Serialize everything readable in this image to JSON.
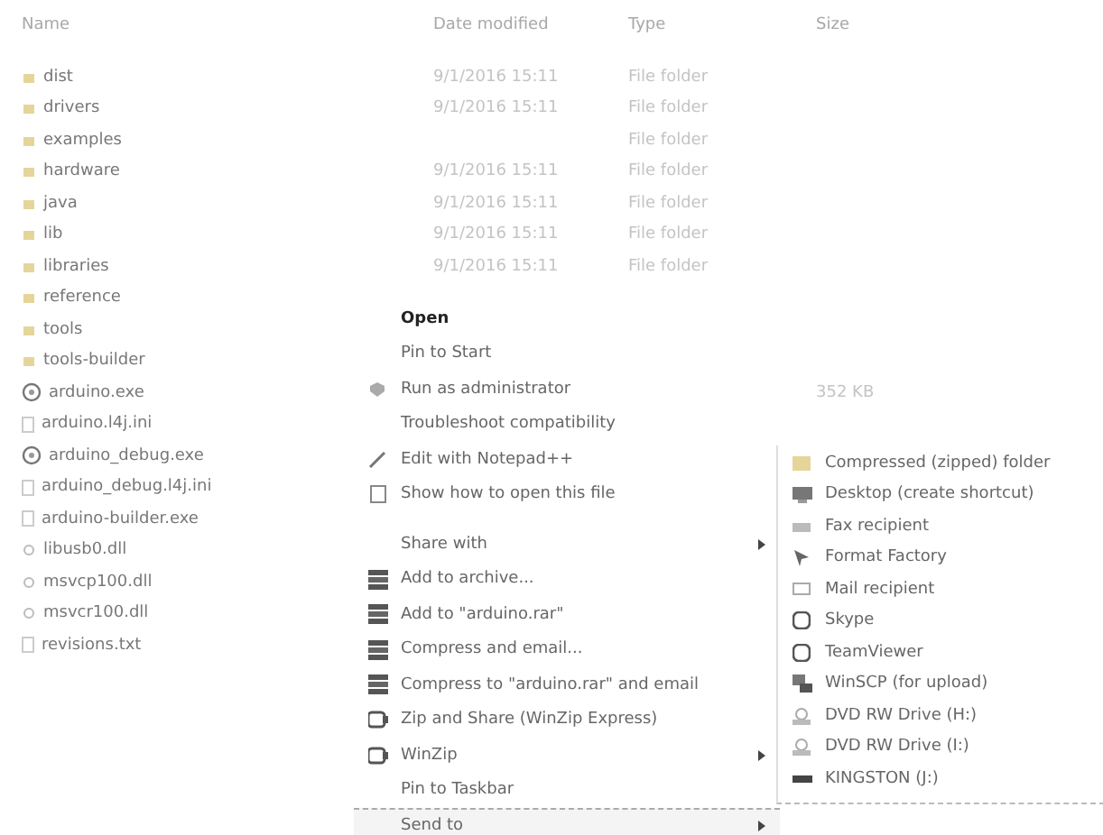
{
  "columns": [
    "Name",
    "Date modified",
    "Type",
    "Size"
  ],
  "files": [
    {
      "name": "dist",
      "kind": "folder",
      "date": "9/1/2016 15:11",
      "type": "File folder"
    },
    {
      "name": "drivers",
      "kind": "folder",
      "date": "9/1/2016 15:11",
      "type": "File folder"
    },
    {
      "name": "examples",
      "kind": "folder",
      "type": "File folder"
    },
    {
      "name": "hardware",
      "kind": "folder",
      "date": "9/1/2016 15:11",
      "type": "File folder"
    },
    {
      "name": "java",
      "kind": "folder",
      "date": "9/1/2016 15:11",
      "type": "File folder"
    },
    {
      "name": "lib",
      "kind": "folder",
      "date": "9/1/2016 15:11",
      "type": "File folder"
    },
    {
      "name": "libraries",
      "kind": "folder",
      "date": "9/1/2016 15:11",
      "type": "File folder"
    },
    {
      "name": "reference",
      "kind": "folder"
    },
    {
      "name": "tools",
      "kind": "folder"
    },
    {
      "name": "tools-builder",
      "kind": "folder"
    },
    {
      "name": "arduino.exe",
      "kind": "app",
      "size": "352 KB"
    },
    {
      "name": "arduino.l4j.ini",
      "kind": "file"
    },
    {
      "name": "arduino_debug.exe",
      "kind": "app"
    },
    {
      "name": "arduino_debug.l4j.ini",
      "kind": "file"
    },
    {
      "name": "arduino-builder.exe",
      "kind": "file"
    },
    {
      "name": "libusb0.dll",
      "kind": "dll"
    },
    {
      "name": "msvcp100.dll",
      "kind": "dll"
    },
    {
      "name": "msvcr100.dll",
      "kind": "dll"
    },
    {
      "name": "revisions.txt",
      "kind": "file"
    }
  ],
  "context_menu": [
    [
      {
        "label": "Open",
        "kind": "default",
        "submenu": false,
        "selected": false
      },
      {
        "label": "Pin to Start",
        "kind": "plain",
        "submenu": false,
        "selected": false
      },
      {
        "label": "Run as administrator",
        "kind": "shield",
        "submenu": false,
        "selected": false
      },
      {
        "label": "Troubleshoot compatibility",
        "kind": "plain",
        "submenu": false,
        "selected": false
      },
      {
        "label": "Edit with Notepad++",
        "kind": "pen",
        "submenu": false,
        "selected": false
      },
      {
        "label": "Show how to open this file",
        "kind": "doc",
        "submenu": false,
        "selected": false
      }
    ],
    [
      {
        "label": "Share with",
        "kind": "plain",
        "submenu": true,
        "selected": false
      },
      {
        "label": "Add to archive...",
        "kind": "books",
        "submenu": false,
        "selected": false
      },
      {
        "label": "Add to \"arduino.rar\"",
        "kind": "books",
        "submenu": false,
        "selected": false
      },
      {
        "label": "Compress and email...",
        "kind": "books",
        "submenu": false,
        "selected": false
      },
      {
        "label": "Compress to \"arduino.rar\" and email",
        "kind": "books",
        "submenu": false,
        "selected": false
      },
      {
        "label": "Zip and Share (WinZip Express)",
        "kind": "vise",
        "submenu": false,
        "selected": false
      },
      {
        "label": "WinZip",
        "kind": "vise",
        "submenu": true,
        "selected": false
      },
      {
        "label": "Pin to Taskbar",
        "kind": "plain",
        "submenu": false,
        "selected": false
      },
      {
        "label": "Send to",
        "kind": "plain",
        "submenu": true,
        "selected": true
      }
    ]
  ],
  "send_to": [
    {
      "label": "Compressed (zipped) folder",
      "kind": "folder"
    },
    {
      "label": "Desktop (create shortcut)",
      "kind": "desktop"
    },
    {
      "label": "Fax recipient",
      "kind": "fax"
    },
    {
      "label": "Format Factory",
      "kind": "arrow"
    },
    {
      "label": "Mail recipient",
      "kind": "mail"
    },
    {
      "label": "Skype",
      "kind": "round"
    },
    {
      "label": "TeamViewer",
      "kind": "round"
    },
    {
      "label": "WinSCP (for upload)",
      "kind": "computer"
    },
    {
      "label": "DVD RW Drive (H:)",
      "kind": "disc"
    },
    {
      "label": "DVD RW Drive (I:)",
      "kind": "disc"
    },
    {
      "label": "KINGSTON (J:)",
      "kind": "drive"
    }
  ]
}
